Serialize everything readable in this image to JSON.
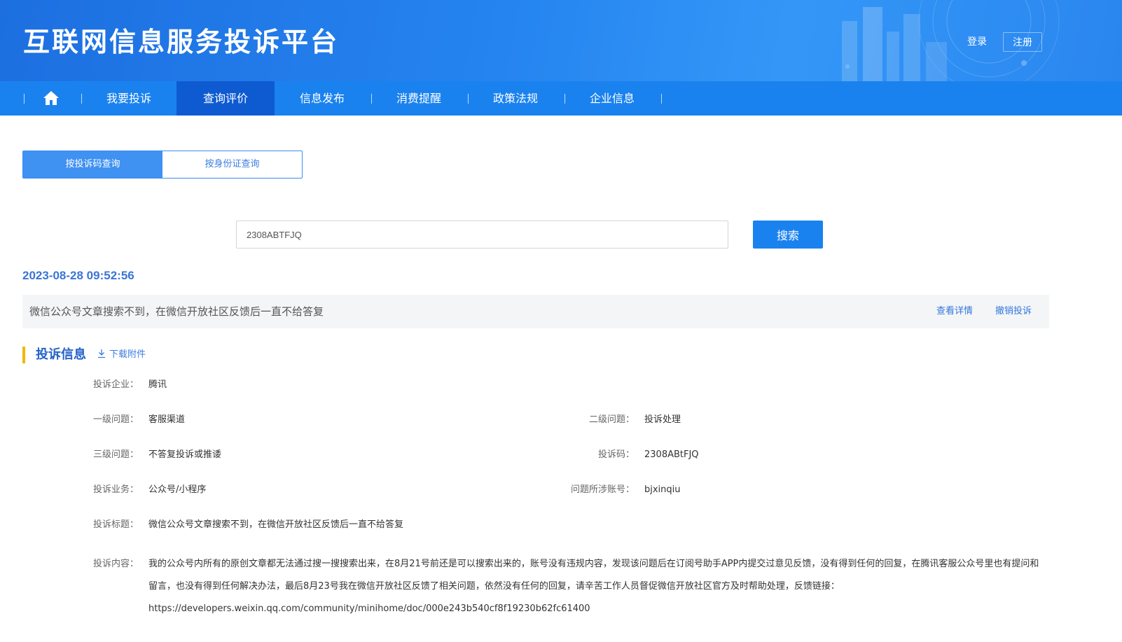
{
  "header": {
    "title": "互联网信息服务投诉平台",
    "login_label": "登录",
    "register_label": "注册"
  },
  "nav": {
    "home_icon": "home-icon",
    "items": [
      {
        "label": "我要投诉"
      },
      {
        "label": "查询评价",
        "active": true
      },
      {
        "label": "信息发布"
      },
      {
        "label": "消费提醒"
      },
      {
        "label": "政策法规"
      },
      {
        "label": "企业信息"
      }
    ]
  },
  "query_tabs": [
    {
      "label": "按投诉码查询",
      "active": true
    },
    {
      "label": "按身份证查询"
    }
  ],
  "search": {
    "value": "2308ABTFJQ",
    "button_label": "搜索"
  },
  "complaint": {
    "timestamp": "2023-08-28 09:52:56",
    "summary": "微信公众号文章搜索不到，在微信开放社区反馈后一直不给答复",
    "view_details_label": "查看详情",
    "withdraw_label": "撤销投诉"
  },
  "section": {
    "title": "投诉信息",
    "download_label": "下载附件"
  },
  "fields": {
    "company": {
      "label": "投诉企业：",
      "value": "腾讯"
    },
    "level1": {
      "label": "一级问题：",
      "value": "客服渠道"
    },
    "level2": {
      "label": "二级问题：",
      "value": "投诉处理"
    },
    "level3": {
      "label": "三级问题：",
      "value": "不答复投诉或推诿"
    },
    "code": {
      "label": "投诉码：",
      "value": "2308ABtFJQ"
    },
    "business": {
      "label": "投诉业务：",
      "value": "公众号/小程序"
    },
    "account": {
      "label": "问题所涉账号：",
      "value": "bjxinqiu"
    },
    "title": {
      "label": "投诉标题：",
      "value": "微信公众号文章搜索不到，在微信开放社区反馈后一直不给答复"
    },
    "content": {
      "label": "投诉内容：",
      "value": "我的公众号内所有的原创文章都无法通过搜一搜搜索出来，在8月21号前还是可以搜索出来的，账号没有违规内容，发现该问题后在订阅号助手APP内提交过意见反馈，没有得到任何的回复，在腾讯客服公众号里也有提问和留言，也没有得到任何解决办法，最后8月23号我在微信开放社区反馈了相关问题，依然没有任何的回复，请辛苦工作人员督促微信开放社区官方及时帮助处理，反馈链接：https://developers.weixin.qq.com/community/minihome/doc/000e243b540cf8f19230b62fc61400"
    }
  },
  "colors": {
    "header_blue": "#2584f0",
    "nav_blue": "#1a82ef",
    "nav_active": "#0e5bd1",
    "accent_yellow": "#f2b705",
    "link_blue": "#2f78dd"
  }
}
